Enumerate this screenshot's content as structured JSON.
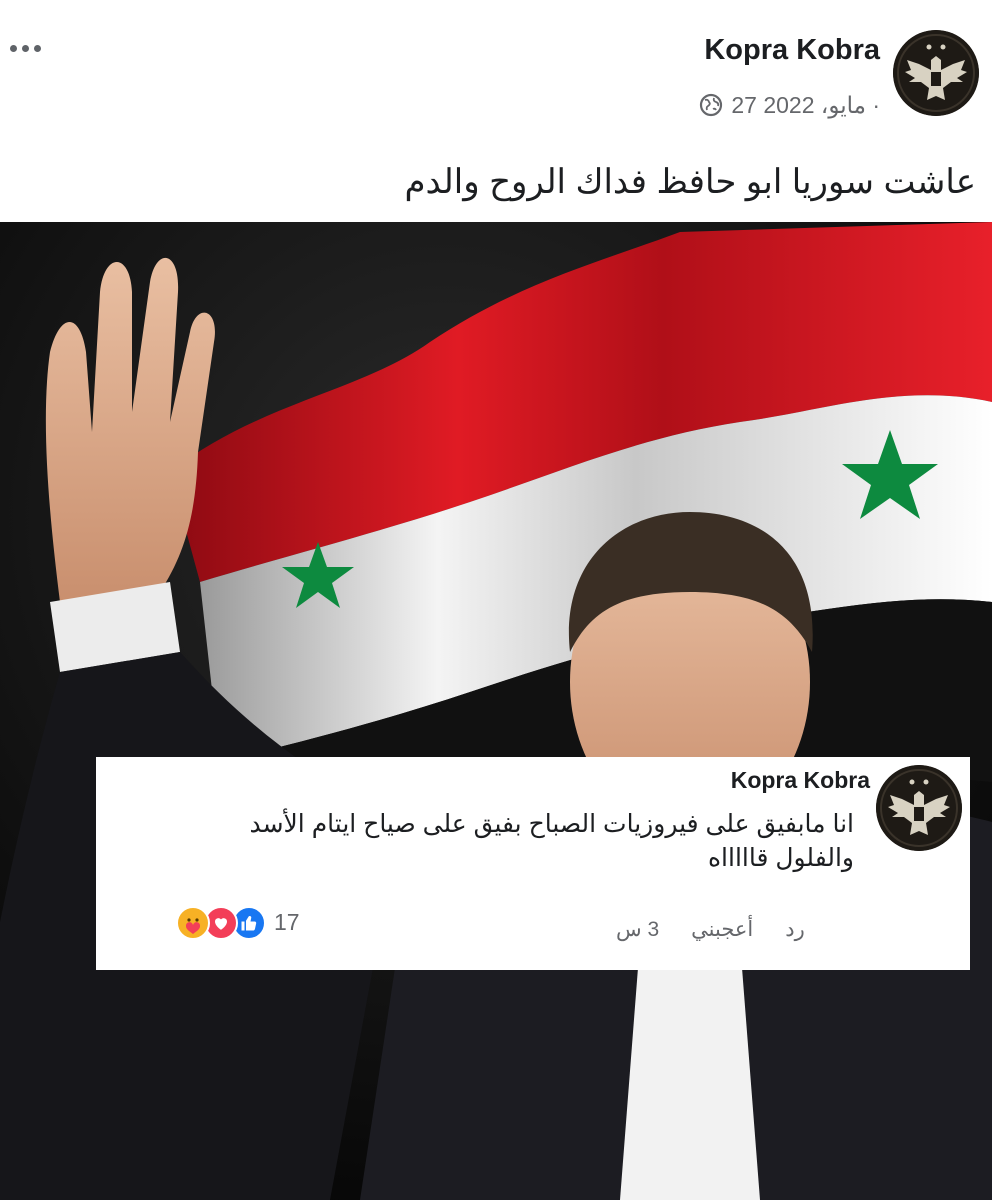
{
  "post": {
    "author": "Kopra Kobra",
    "date": "27 مايو، 2022 ·",
    "text": "عاشت سوريا ابو حافظ فداك الروح والدم",
    "menu_icon": "more-horizontal-icon",
    "privacy_icon": "globe-icon"
  },
  "comment": {
    "author": "Kopra Kobra",
    "text_line1": "انا مابفيق على فيروزيات الصباح بفيق على صياح ايتام الأسد",
    "text_line2": "والفلول قاااااه",
    "time": "3 س",
    "like_label": "أعجبني",
    "reply_label": "رد",
    "reaction_count": "17",
    "reaction_icons": [
      "like-icon",
      "love-icon",
      "care-icon"
    ]
  },
  "colors": {
    "flag_red": "#ce1126",
    "flag_white": "#ffffff",
    "flag_black": "#000000",
    "flag_star_green": "#007a3d",
    "like_blue": "#1877f2",
    "love_red": "#f33e58",
    "care_yellow": "#f7b125",
    "secondary_text": "#65676b"
  }
}
